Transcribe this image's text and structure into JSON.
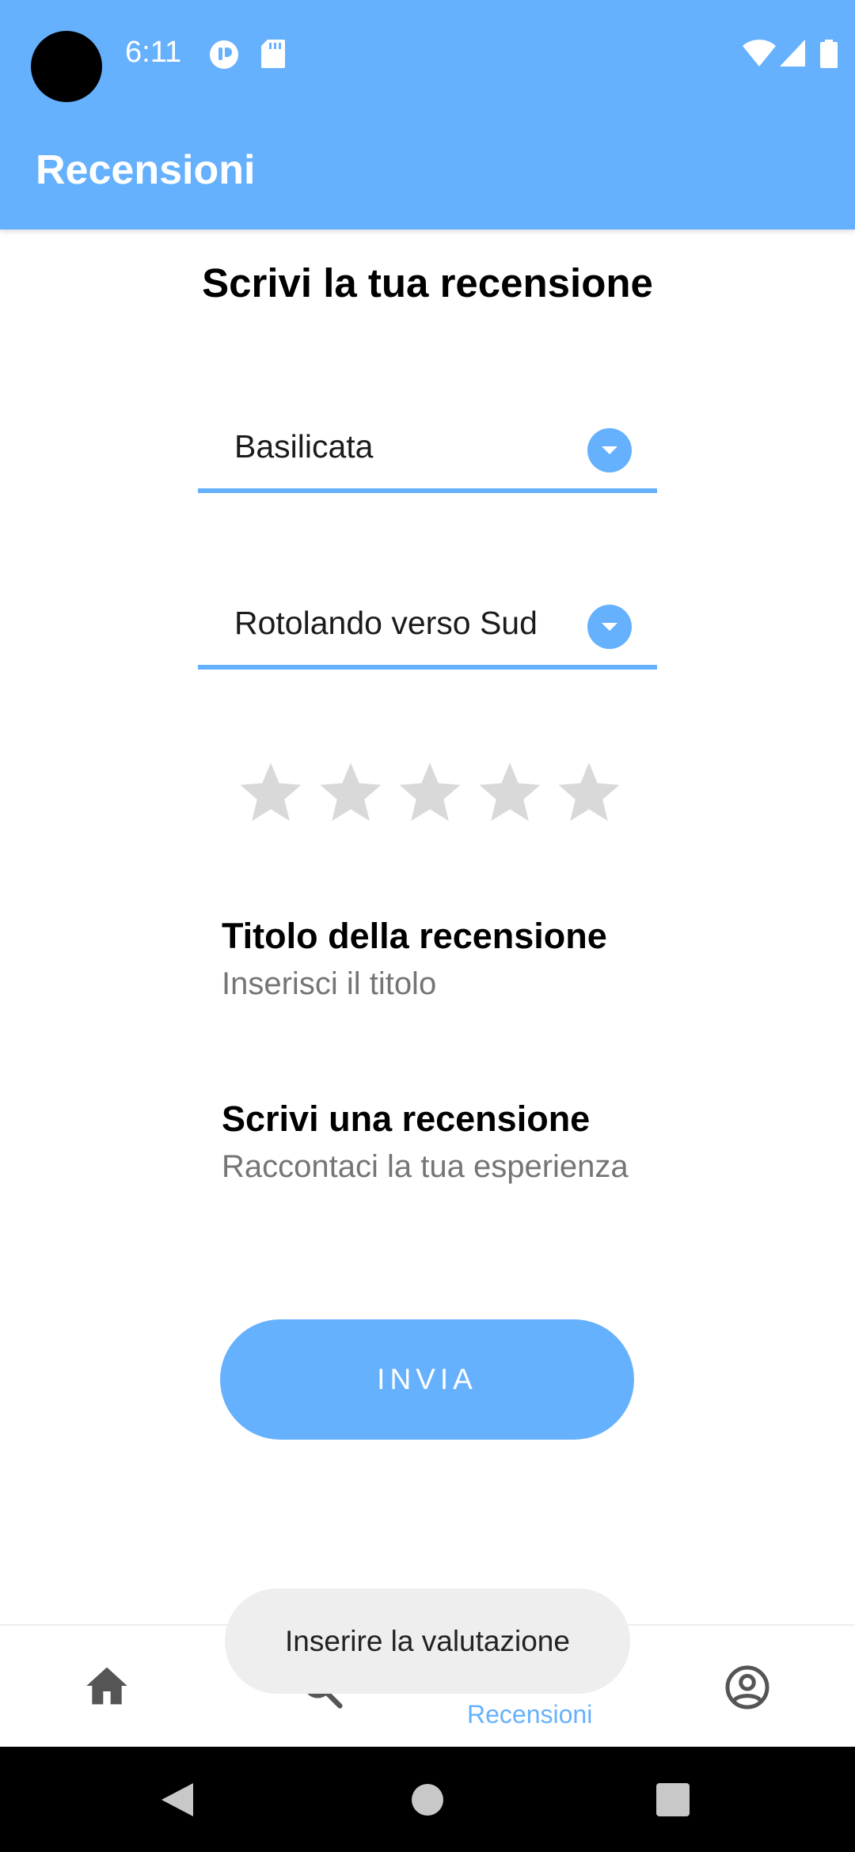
{
  "status_bar": {
    "time": "6:11",
    "icons": [
      "data-saver-icon",
      "sd-card-icon",
      "wifi-icon",
      "signal-icon",
      "battery-icon"
    ]
  },
  "app_bar": {
    "title": "Recensioni"
  },
  "main": {
    "heading": "Scrivi la tua recensione",
    "region_dropdown": {
      "selected": "Basilicata"
    },
    "place_dropdown": {
      "selected": "Rotolando verso Sud"
    },
    "rating": {
      "value": 0,
      "max": 5
    },
    "title_field": {
      "label": "Titolo della recensione",
      "placeholder": "Inserisci il titolo",
      "value": ""
    },
    "review_field": {
      "label": "Scrivi una recensione",
      "placeholder": "Raccontaci la tua esperienza",
      "value": ""
    },
    "submit_label": "INVIA"
  },
  "toast": {
    "message": "Inserire la valutazione"
  },
  "bottom_nav": {
    "items": [
      {
        "icon": "home-icon",
        "label": ""
      },
      {
        "icon": "search-icon",
        "label": ""
      },
      {
        "icon": "edit-icon",
        "label": "Recensioni",
        "active": true
      },
      {
        "icon": "account-icon",
        "label": ""
      }
    ]
  },
  "colors": {
    "accent": "#66b1fd",
    "star_empty": "#d9d9d9",
    "placeholder": "#a5a5a5"
  }
}
